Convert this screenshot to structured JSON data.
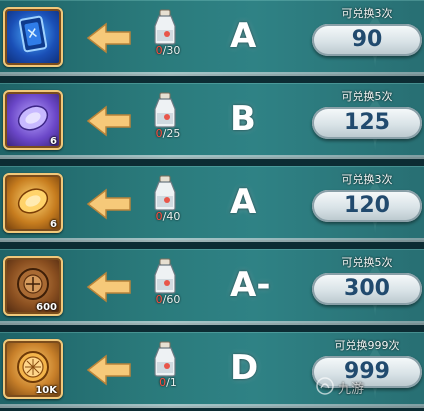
{
  "exchange_list": {
    "rows": [
      {
        "item_icon": "blue-card-icon",
        "item_count": "",
        "cost_have": "0",
        "cost_total": "/30",
        "grade": "A",
        "limit": "可兑换3次",
        "price": "90",
        "frame_color": "blue"
      },
      {
        "item_icon": "purple-gem-icon",
        "item_count": "6",
        "cost_have": "0",
        "cost_total": "/25",
        "grade": "B",
        "limit": "可兑换5次",
        "price": "125",
        "frame_color": "purple"
      },
      {
        "item_icon": "amber-gem-icon",
        "item_count": "6",
        "cost_have": "0",
        "cost_total": "/40",
        "grade": "A",
        "limit": "可兑换3次",
        "price": "120",
        "frame_color": "amber"
      },
      {
        "item_icon": "bronze-medal-icon",
        "item_count": "600",
        "cost_have": "0",
        "cost_total": "/60",
        "grade": "A-",
        "limit": "可兑换5次",
        "price": "300",
        "frame_color": "bronze"
      },
      {
        "item_icon": "gold-coin-icon",
        "item_count": "10K",
        "cost_have": "0",
        "cost_total": "/1",
        "grade": "D",
        "limit": "可兑换999次",
        "price": "999",
        "frame_color": "gold"
      }
    ]
  },
  "currency_icon": "potion-bottle-icon",
  "arrow_icon": "arrow-left-icon",
  "watermark": "九游"
}
